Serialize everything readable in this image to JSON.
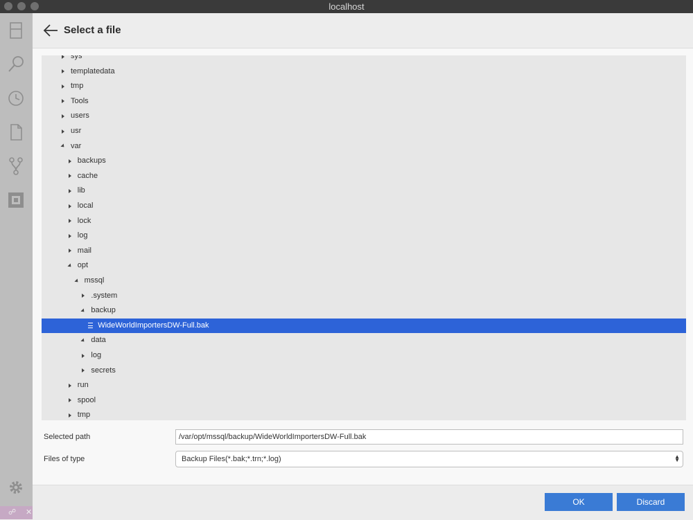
{
  "window": {
    "title": "localhost"
  },
  "dialog": {
    "title": "Select a file"
  },
  "tree": [
    {
      "label": "sys",
      "depth": 0,
      "state": "collapsed"
    },
    {
      "label": "templatedata",
      "depth": 0,
      "state": "collapsed"
    },
    {
      "label": "tmp",
      "depth": 0,
      "state": "collapsed"
    },
    {
      "label": "Tools",
      "depth": 0,
      "state": "collapsed"
    },
    {
      "label": "users",
      "depth": 0,
      "state": "collapsed"
    },
    {
      "label": "usr",
      "depth": 0,
      "state": "collapsed"
    },
    {
      "label": "var",
      "depth": 0,
      "state": "expanded"
    },
    {
      "label": "backups",
      "depth": 1,
      "state": "collapsed"
    },
    {
      "label": "cache",
      "depth": 1,
      "state": "collapsed"
    },
    {
      "label": "lib",
      "depth": 1,
      "state": "collapsed"
    },
    {
      "label": "local",
      "depth": 1,
      "state": "collapsed"
    },
    {
      "label": "lock",
      "depth": 1,
      "state": "collapsed"
    },
    {
      "label": "log",
      "depth": 1,
      "state": "collapsed"
    },
    {
      "label": "mail",
      "depth": 1,
      "state": "collapsed"
    },
    {
      "label": "opt",
      "depth": 1,
      "state": "expanded"
    },
    {
      "label": "mssql",
      "depth": 2,
      "state": "expanded"
    },
    {
      "label": ".system",
      "depth": 3,
      "state": "collapsed"
    },
    {
      "label": "backup",
      "depth": 3,
      "state": "expanded"
    },
    {
      "label": "WideWorldImportersDW-Full.bak",
      "depth": 4,
      "state": "file",
      "selected": true
    },
    {
      "label": "data",
      "depth": 3,
      "state": "expanded"
    },
    {
      "label": "log",
      "depth": 3,
      "state": "collapsed"
    },
    {
      "label": "secrets",
      "depth": 3,
      "state": "collapsed"
    },
    {
      "label": "run",
      "depth": 1,
      "state": "collapsed"
    },
    {
      "label": "spool",
      "depth": 1,
      "state": "collapsed"
    },
    {
      "label": "tmp",
      "depth": 1,
      "state": "collapsed"
    }
  ],
  "form": {
    "selected_path_label": "Selected path",
    "selected_path_value": "/var/opt/mssql/backup/WideWorldImportersDW-Full.bak",
    "files_of_type_label": "Files of type",
    "files_of_type_value": "Backup Files(*.bak;*.trn;*.log)"
  },
  "buttons": {
    "ok": "OK",
    "discard": "Discard"
  },
  "activity_icons": [
    "explorer-icon",
    "search-icon",
    "history-icon",
    "file-icon",
    "source-control-icon",
    "extensions-icon",
    "settings-icon"
  ],
  "colors": {
    "selection": "#2d63d8",
    "button": "#3a7bd5",
    "activity_bar": "#bdbdbd",
    "titlebar": "#3a3a3a"
  }
}
